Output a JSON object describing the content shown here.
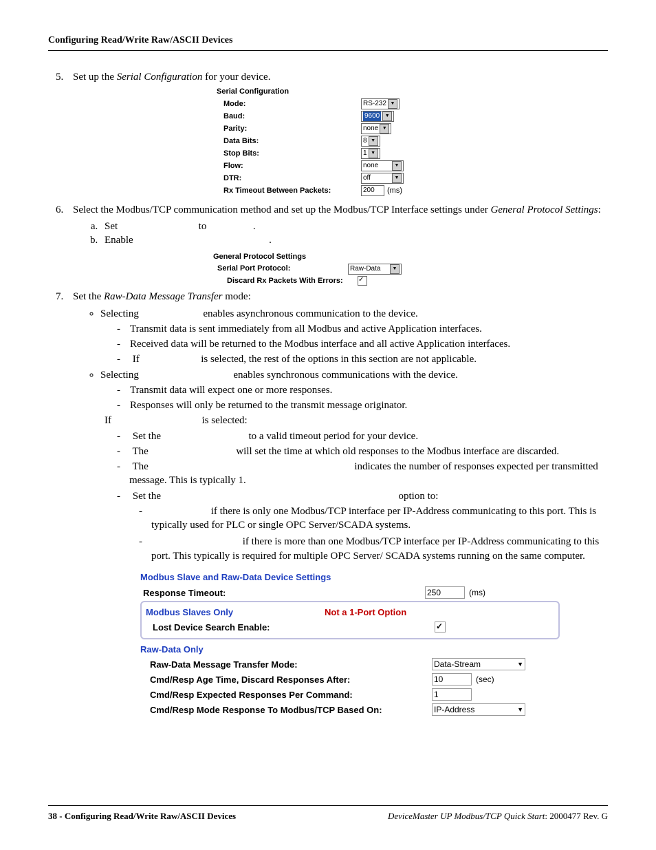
{
  "header": "Configuring Read/Write Raw/ASCII Devices",
  "step5": {
    "num": "5.",
    "text_a": "Set up the ",
    "text_b": "Serial Configuration",
    "text_c": " for your device."
  },
  "serial_ui": {
    "title": "Serial Configuration",
    "mode": {
      "label": "Mode:",
      "value": "RS-232"
    },
    "baud": {
      "label": "Baud:",
      "value": "9600"
    },
    "parity": {
      "label": "Parity:",
      "value": "none"
    },
    "databits": {
      "label": "Data Bits:",
      "value": "8"
    },
    "stopbits": {
      "label": "Stop Bits:",
      "value": "1"
    },
    "flow": {
      "label": "Flow:",
      "value": "none"
    },
    "dtr": {
      "label": "DTR:",
      "value": "off"
    },
    "rxto": {
      "label": "Rx Timeout Between Packets:",
      "value": "200",
      "unit": "(ms)"
    }
  },
  "step6": {
    "num": "6.",
    "text_a": "Select the Modbus/TCP communication method and set up the Modbus/TCP Interface settings under ",
    "text_b": "General Protocol Settings",
    "text_c": ":",
    "a_pre": "Set",
    "a_mid": "to",
    "a_end": ".",
    "b_pre": "Enable",
    "b_end": "."
  },
  "gps_ui": {
    "title": "General Protocol Settings",
    "spp_label": "Serial Port Protocol:",
    "spp_value": "Raw-Data",
    "discard_label": "Discard Rx Packets With Errors:"
  },
  "step7": {
    "num": "7.",
    "text_a": "Set the ",
    "text_b": "Raw-Data Message Transfer",
    "text_c": " mode:",
    "b1_a": "Selecting",
    "b1_b": "enables asynchronous communication to the device.",
    "b1_d1": "Transmit data is sent immediately from all Modbus and active Application interfaces.",
    "b1_d2": "Received data will be returned to the Modbus interface and all active Application interfaces.",
    "b1_d3_a": "If",
    "b1_d3_b": "is selected, the rest of the options in this section are not applicable.",
    "b2_a": "Selecting",
    "b2_b": "enables synchronous communications with the device.",
    "b2_d1": "Transmit data will expect one or more responses.",
    "b2_d2": "Responses will only be returned to the transmit message originator.",
    "if_a": "If",
    "if_b": "is selected:",
    "d_set_a": "Set the",
    "d_set_b": "to a valid timeout period for your device.",
    "d_age_a": "The",
    "d_age_b": "will set the time at which old responses to the Modbus interface are discarded.",
    "d_exp_a": "The",
    "d_exp_b": "indicates the number of responses expected per transmitted message. This is typically 1.",
    "d_mode_a": "Set the",
    "d_mode_b": "option to:",
    "sd1": "if there is only one Modbus/TCP interface per IP-Address communicating to this port. This is typically used for PLC or single OPC Server/SCADA systems.",
    "sd2": "if there is more than one Modbus/TCP interface per IP-Address communicating to this port. This typically is required for multiple OPC Server/ SCADA systems running on the same computer."
  },
  "mb_ui": {
    "title": "Modbus Slave and Raw-Data Device Settings",
    "resp_label": "Response Timeout:",
    "resp_value": "250",
    "resp_unit": "(ms)",
    "slaves_only": "Modbus Slaves Only",
    "not1port": "Not a 1-Port Option",
    "lost_label": "Lost Device Search Enable:",
    "raw_only": "Raw-Data Only",
    "rdm_label": "Raw-Data Message Transfer Mode:",
    "rdm_value": "Data-Stream",
    "age_label": "Cmd/Resp Age Time, Discard Responses After:",
    "age_value": "10",
    "age_unit": "(sec)",
    "exp_label": "Cmd/Resp Expected Responses Per Command:",
    "exp_value": "1",
    "basedon_label": "Cmd/Resp Mode Response To Modbus/TCP Based On:",
    "basedon_value": "IP-Address"
  },
  "footer": {
    "left_a": "38 - Configuring Read/Write Raw/ASCII Devices",
    "right_a": "DeviceMaster UP Modbus/TCP Quick Start",
    "right_b": ": 2000477 Rev. G"
  }
}
